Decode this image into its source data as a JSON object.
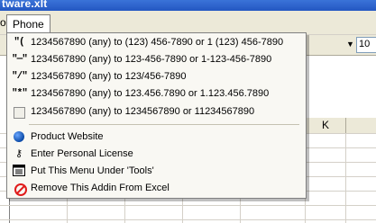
{
  "window": {
    "title_fragment": "tware.xlt"
  },
  "menubar": {
    "partial_left": "o",
    "open_menu": "Phone"
  },
  "toolbar": {
    "font_size_value": "10"
  },
  "sheet": {
    "visible_column": "K"
  },
  "dropdown": {
    "formats": [
      {
        "icon": "paren-dash-format-icon",
        "glyph": "\"(",
        "label": "1234567890 (any) to (123) 456-7890 or 1 (123) 456-7890"
      },
      {
        "icon": "dash-format-icon",
        "glyph": "\"—\"",
        "label": "1234567890 (any) to 123-456-7890 or 1-123-456-7890"
      },
      {
        "icon": "slash-format-icon",
        "glyph": "\"/\"",
        "label": "1234567890 (any) to 123/456-7890"
      },
      {
        "icon": "dot-format-icon",
        "glyph": "\"*\"",
        "label": "1234567890 (any) to 123.456.7890 or 1.123.456.7890"
      },
      {
        "icon": "checkbox-format-icon",
        "glyph": "",
        "label": "1234567890 (any) to 1234567890 or 11234567890"
      }
    ],
    "actions": [
      {
        "icon": "globe-icon",
        "label": "Product Website"
      },
      {
        "icon": "key-icon",
        "label": "Enter Personal License"
      },
      {
        "icon": "menu-tools-icon",
        "label": "Put This Menu Under 'Tools'"
      },
      {
        "icon": "remove-icon",
        "label": "Remove This Addin From Excel"
      }
    ]
  }
}
